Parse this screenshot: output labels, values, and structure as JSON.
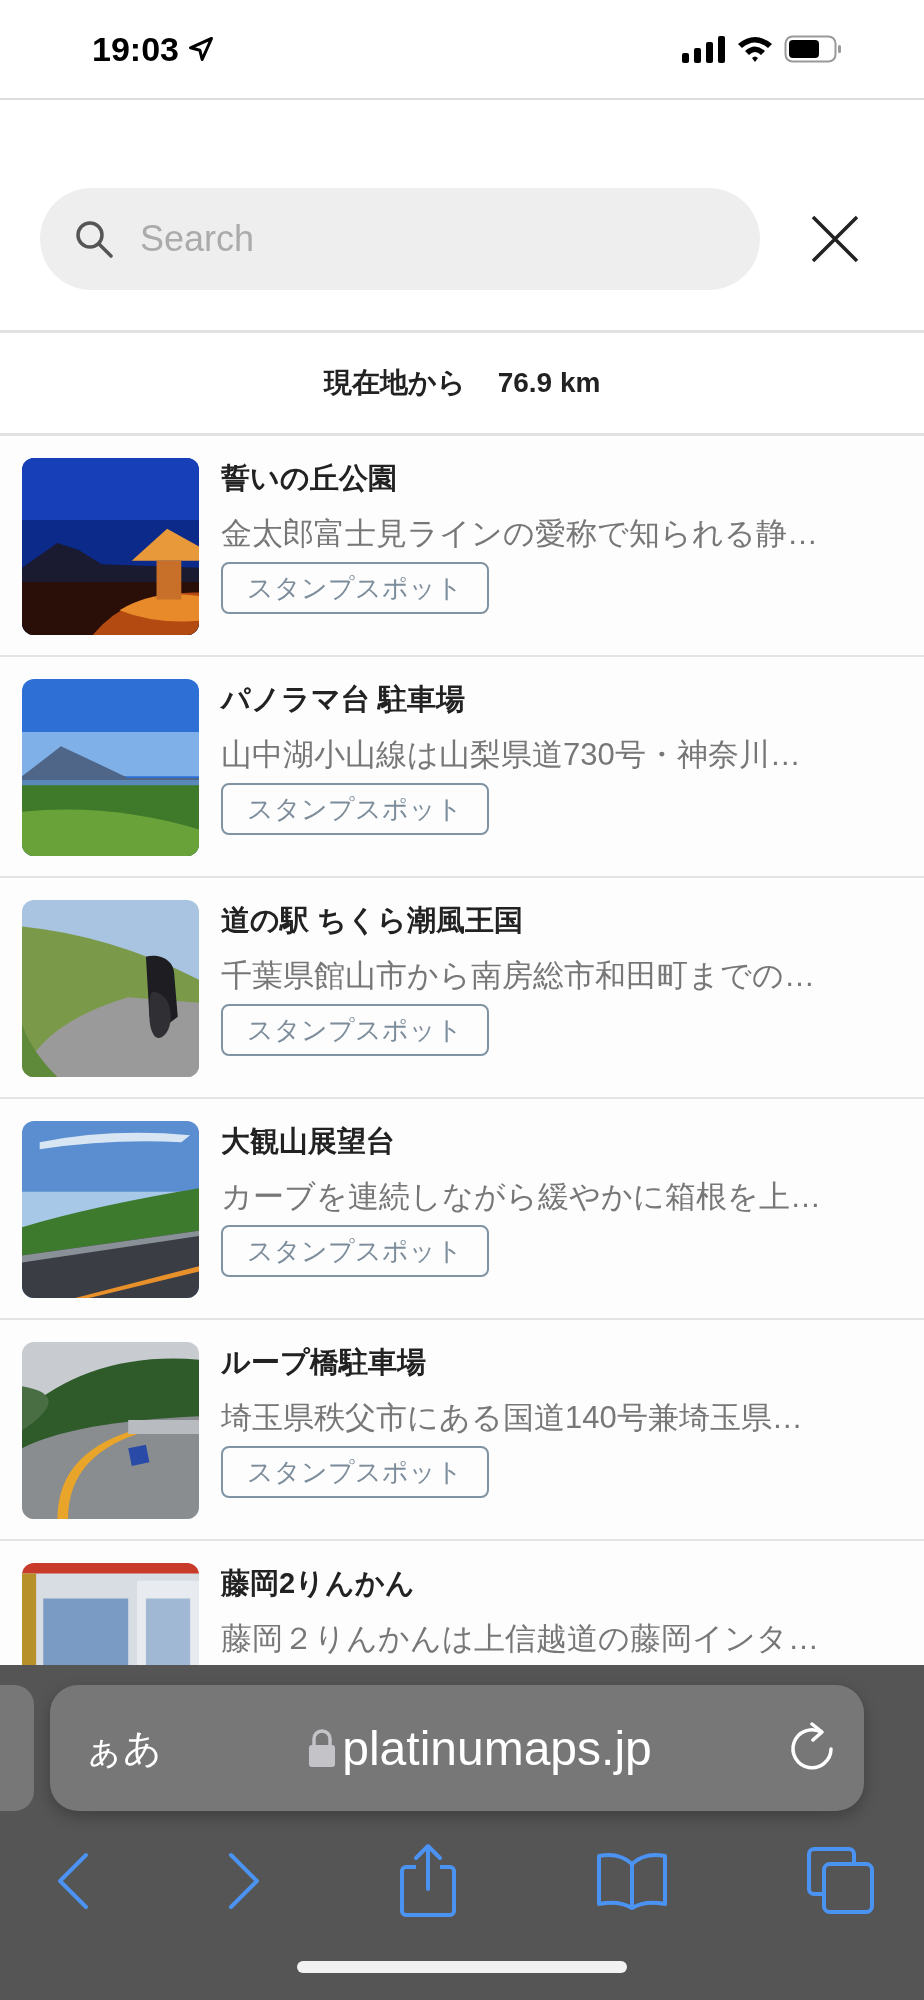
{
  "status_bar": {
    "time": "19:03"
  },
  "search": {
    "placeholder": "Search"
  },
  "distance": {
    "label": "現在地から",
    "value": "76.9 km"
  },
  "spots": [
    {
      "title": "誓いの丘公園",
      "description": "金太郎富士見ラインの愛称で知られる静…",
      "tag": "スタンプスポット"
    },
    {
      "title": "パノラマ台 駐車場",
      "description": "山中湖小山線は山梨県道730号・神奈川…",
      "tag": "スタンプスポット"
    },
    {
      "title": "道の駅 ちくら潮風王国",
      "description": "千葉県館山市から南房総市和田町までの…",
      "tag": "スタンプスポット"
    },
    {
      "title": "大観山展望台",
      "description": "カーブを連続しながら緩やかに箱根を上…",
      "tag": "スタンプスポット"
    },
    {
      "title": "ループ橋駐車場",
      "description": "埼玉県秩父市にある国道140号兼埼玉県…",
      "tag": "スタンプスポット"
    },
    {
      "title": "藤岡2りんかん",
      "description": "藤岡２りんかんは上信越道の藤岡インタ…"
    }
  ],
  "browser": {
    "text_size_button": "ぁあ",
    "url": "platinumaps.jp"
  }
}
